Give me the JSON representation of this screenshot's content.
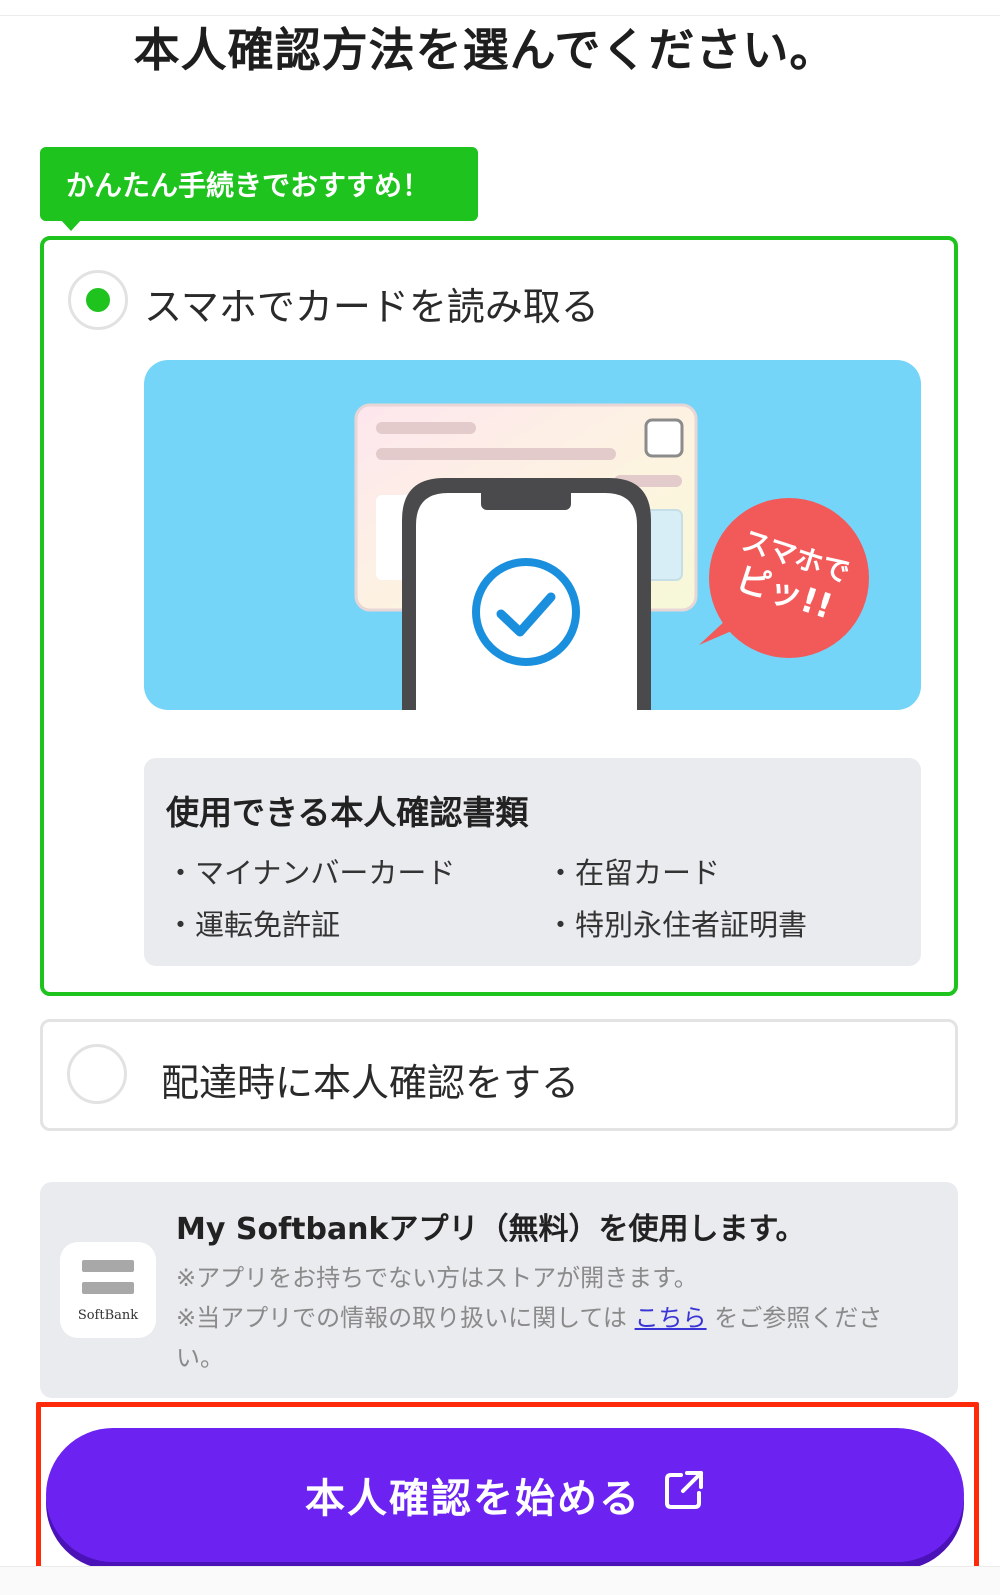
{
  "page": {
    "title": "本人確認方法を選んでください。"
  },
  "badge": {
    "text": "かんたん手続きでおすすめ！"
  },
  "option_nfc": {
    "label": "スマホでカードを読み取る",
    "selected": true,
    "bubble_line1": "スマホで",
    "bubble_line2": "ピッ!!",
    "docs_heading": "使用できる本人確認書類",
    "docs": [
      "・マイナンバーカード",
      "・在留カード",
      "・運転免許証",
      "・特別永住者証明書"
    ]
  },
  "option_delivery": {
    "label": "配達時に本人確認をする",
    "selected": false
  },
  "app_info": {
    "icon_text": "SoftBank",
    "title": "My Softbankアプリ（無料）を使用します。",
    "note1": "※アプリをお持ちでない方はストアが開きます。",
    "note2_prefix": "※当アプリでの情報の取り扱いに関しては",
    "note2_link": "こちら",
    "note2_suffix": "をご参照ください。"
  },
  "cta": {
    "label": "本人確認を始める",
    "icon": "external-link-icon"
  },
  "colors": {
    "accent_green": "#1ec31e",
    "primary_purple": "#6c23f2",
    "highlight_red": "#ff2a0a",
    "illustration_bg": "#75d5f8",
    "bubble_red": "#f25a5a",
    "check_blue": "#1a8fdd"
  }
}
